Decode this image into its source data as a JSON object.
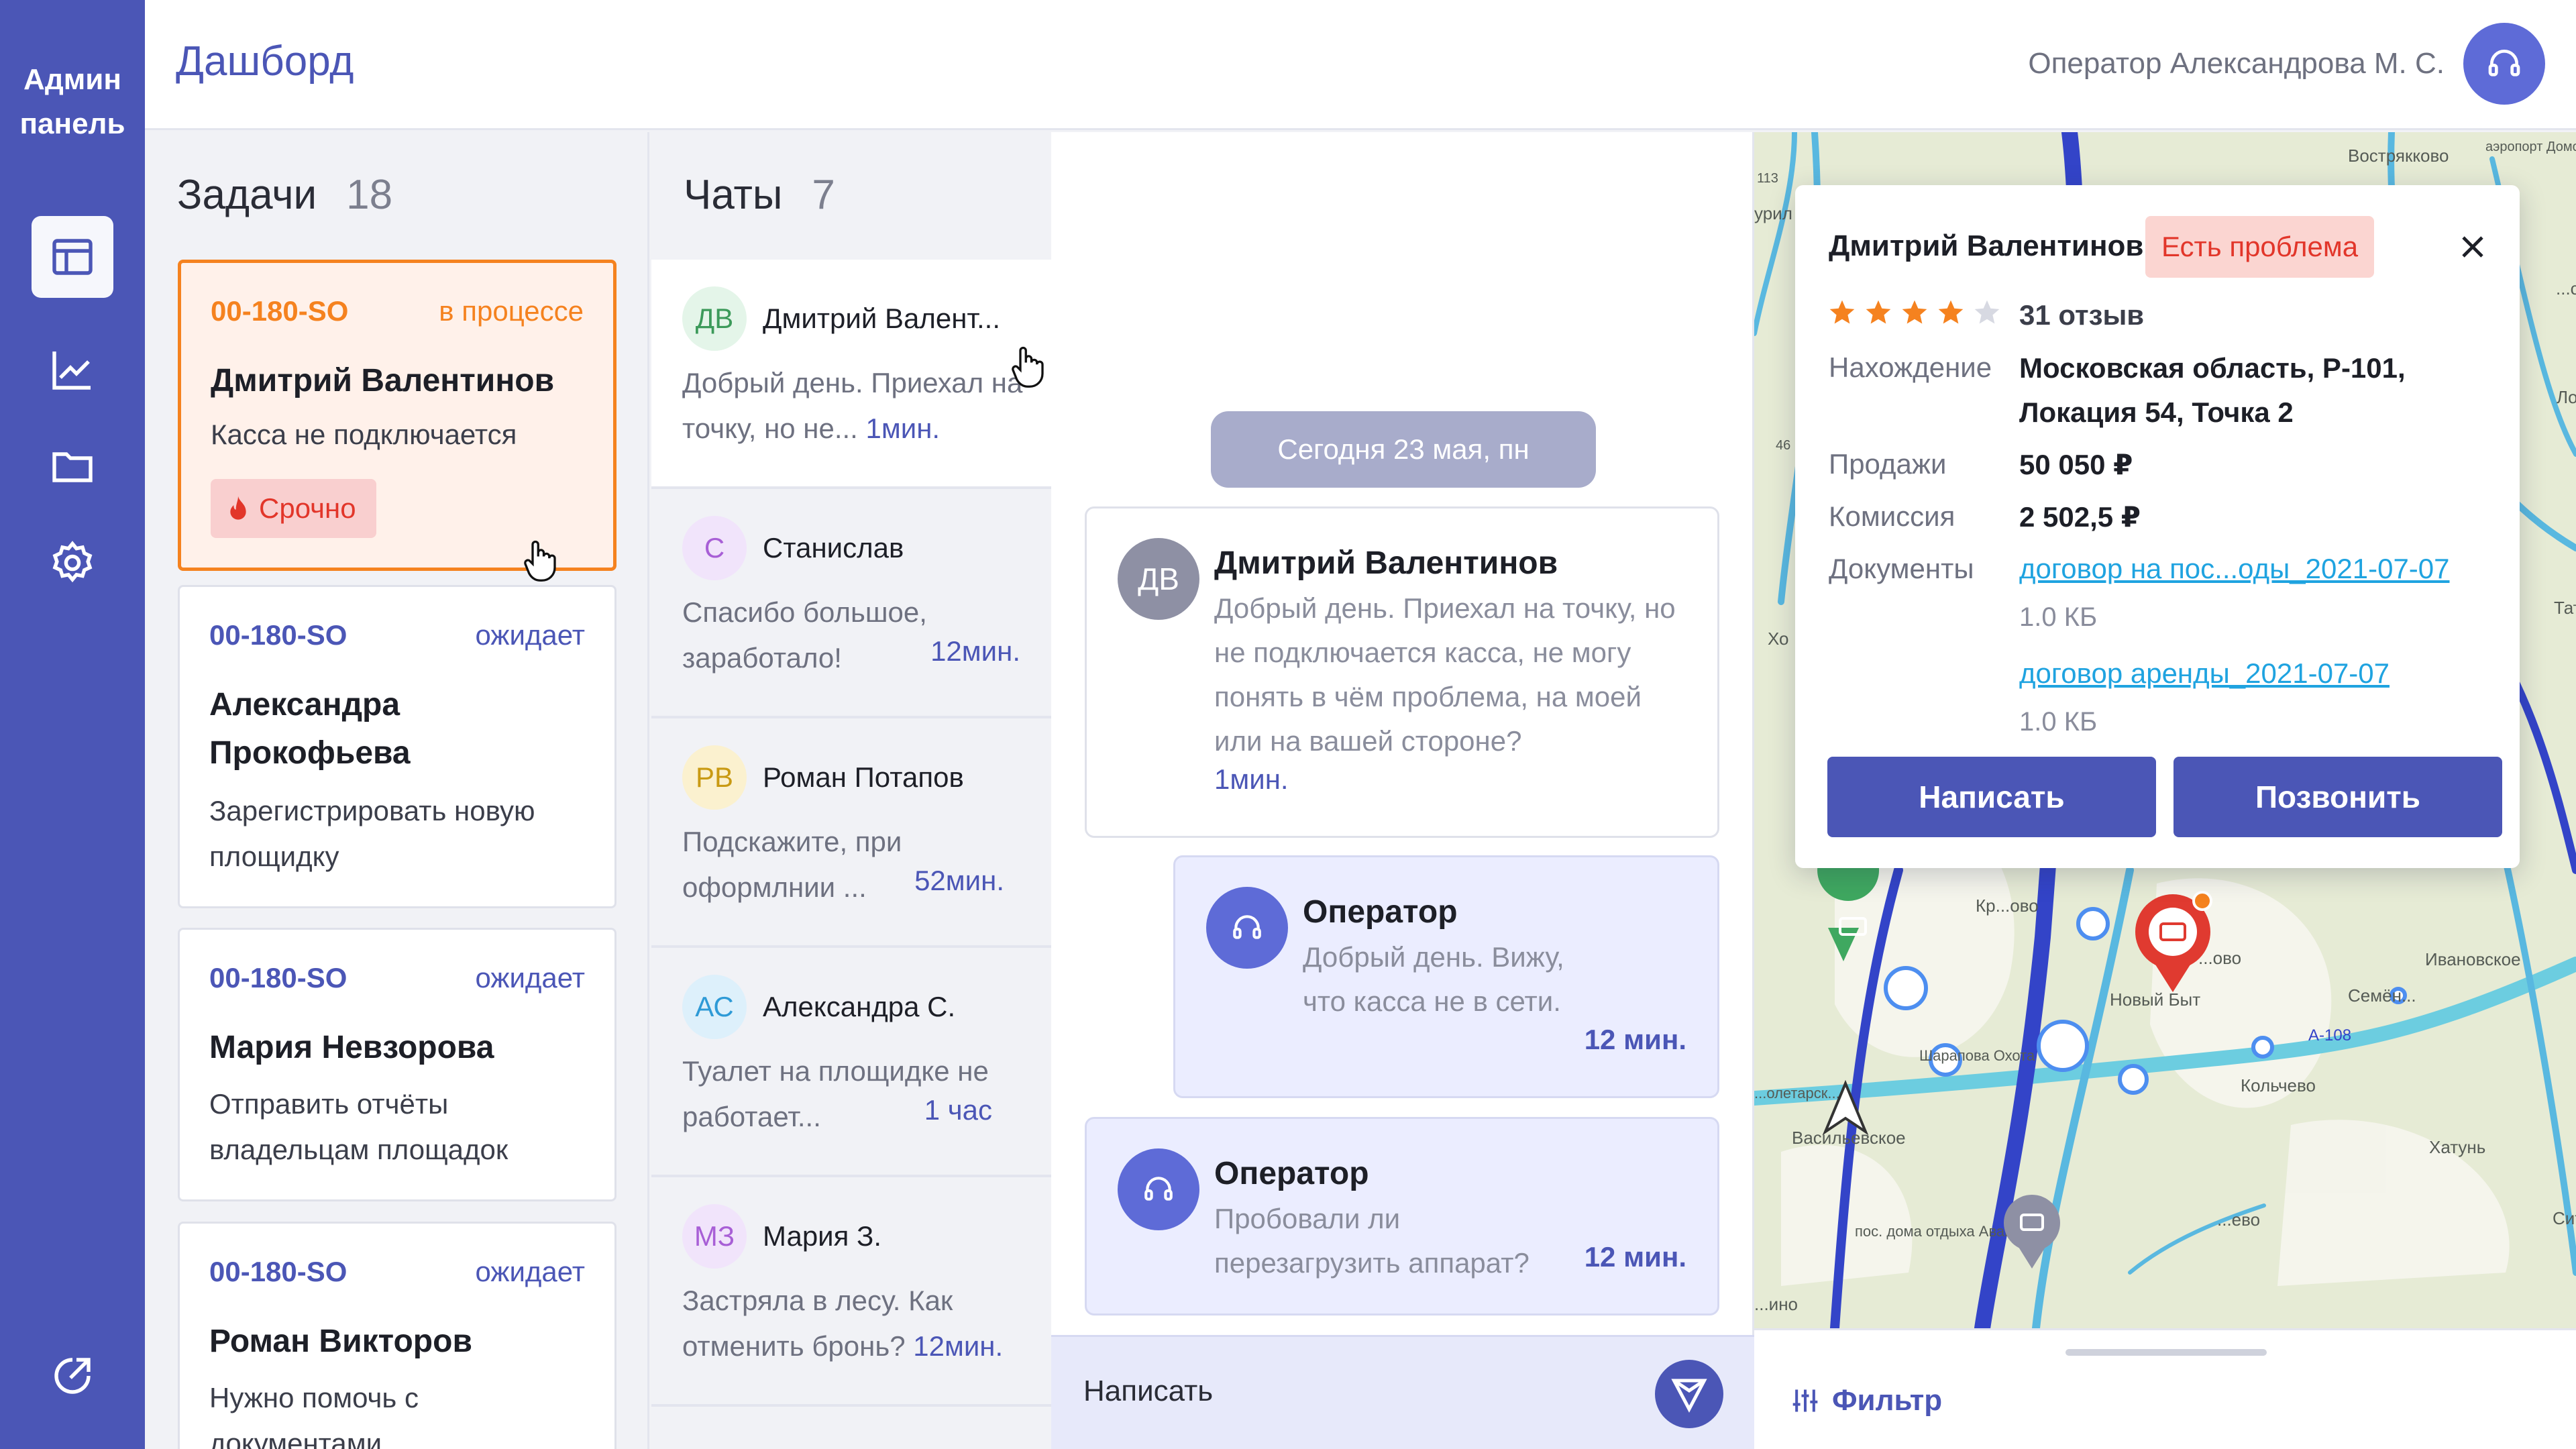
{
  "rail": {
    "brand": "Админ панель",
    "items": [
      {
        "icon": "layout-icon",
        "active": true
      },
      {
        "icon": "chart-icon",
        "active": false
      },
      {
        "icon": "folder-icon",
        "active": false
      },
      {
        "icon": "gear-icon",
        "active": false
      }
    ],
    "bottom_icon": "external-link-icon"
  },
  "header": {
    "title": "Дашборд",
    "operator": "Оператор Александрова М. С."
  },
  "tasks": {
    "title": "Задачи",
    "count": "18",
    "items": [
      {
        "id": "00-180-SO",
        "status": "в процессе",
        "name": "Дмитрий Валентинов",
        "desc": "Касса не подключается",
        "urgent": "Срочно"
      },
      {
        "id": "00-180-SO",
        "status": "ожидает",
        "name": "Александра Прокофьева",
        "desc": "Зарегистрировать новую площидку"
      },
      {
        "id": "00-180-SO",
        "status": "ожидает",
        "name": "Мария Невзорова",
        "desc": "Отправить отчёты владельцам площадок"
      },
      {
        "id": "00-180-SO",
        "status": "ожидает",
        "name": "Роман Викторов",
        "desc": "Нужно помочь с документами"
      }
    ]
  },
  "chats": {
    "title": "Чаты",
    "count": "7",
    "items": [
      {
        "initials": "ДВ",
        "name": "Дмитрий Валент...",
        "preview": "Добрый день. Приехал на точку, но не...",
        "time": "1мин.",
        "bg": "#e4f5e9",
        "fg": "#3c9a5a"
      },
      {
        "initials": "С",
        "name": "Станислав",
        "preview": "Спасибо большое, заработало!",
        "time": "12мин.",
        "bg": "#f1e4fb",
        "fg": "#a85fd6"
      },
      {
        "initials": "РВ",
        "name": "Роман Потапов",
        "preview": "Подскажите, при оформлнии ...",
        "time": "52мин.",
        "bg": "#fbf1cf",
        "fg": "#c99a13"
      },
      {
        "initials": "АС",
        "name": "Александра С.",
        "preview": "Туалет на площидке не работает...",
        "time": "1 час",
        "bg": "#ddf0fb",
        "fg": "#2e9ad6"
      },
      {
        "initials": "МЗ",
        "name": "Мария З.",
        "preview": "Застряла в лесу. Как отменить бронь?",
        "time": "12мин.",
        "bg": "#f1e4fb",
        "fg": "#a85fd6"
      }
    ]
  },
  "conversation": {
    "date": "Сегодня 23 мая, пн",
    "messages": [
      {
        "initials": "ДВ",
        "name": "Дмитрий Валентинов",
        "text": "Добрый день. Приехал на точку, но не подключается касса, не могу понять в чём проблема, на моей или на вашей стороне?",
        "time": "1мин."
      },
      {
        "name": "Оператор",
        "text": "Добрый день. Вижу, что касса не в сети.",
        "time": "12 мин."
      },
      {
        "name": "Оператор",
        "text": "Пробовали ли перезагрузить аппарат?",
        "time": "12 мин."
      }
    ],
    "composer_placeholder": "Написать"
  },
  "popup": {
    "name": "Дмитрий Валентинов",
    "badge": "Есть проблема",
    "rating": 4,
    "reviews": "31 отзыв",
    "location_label": "Нахождение",
    "location": "Московская область, Р-101, Локация 54, Точка 2",
    "sales_label": "Продажи",
    "sales": "50 050 ₽",
    "commission_label": "Комиссия",
    "commission": "2 502,5 ₽",
    "docs_label": "Документы",
    "docs": [
      {
        "name": "договор на пос...оды_2021-07-07",
        "size": "1.0 КБ"
      },
      {
        "name": "договор аренды_2021-07-07",
        "size": "1.0 КБ"
      }
    ],
    "write": "Написать",
    "call": "Позвонить"
  },
  "map": {
    "labels": [
      "Вострякково",
      "аэропорт Домодедово DME",
      "Кр...ово",
      "Новый Быт",
      "Семён...",
      "Ивановское",
      "А-108",
      "Кольчево",
      "Хатунь",
      "Шарапова Охота",
      "Васильевское",
      "пос. дома отдыха Авангард",
      "...ево",
      "113",
      "46",
      "урил",
      "Хо",
      "Ло",
      "Татар",
      "Сит",
      "...ово",
      "...олетарск...",
      "...ино",
      "...сный"
    ],
    "filter": "Фильтр"
  },
  "colors": {
    "brand": "#4b56b6",
    "accent": "#f5821f",
    "danger": "#e2362a",
    "link": "#1fa3e0"
  }
}
